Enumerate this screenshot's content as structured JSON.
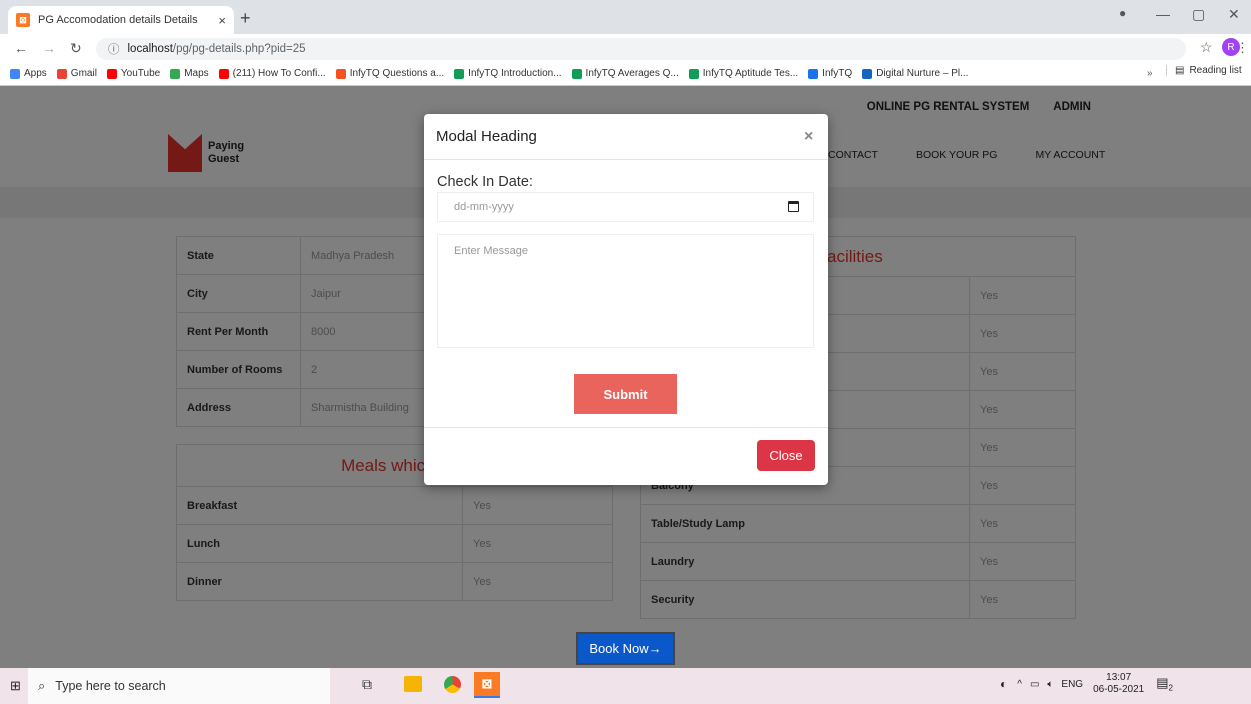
{
  "browser": {
    "tab_title": "PG Accomodation details Details",
    "tab_close": "×",
    "new_tab": "+",
    "url_host": "localhost",
    "url_path": "/pg/pg-details.php?pid=25",
    "bookmarks": [
      {
        "label": "Apps",
        "color": "#4285f4"
      },
      {
        "label": "Gmail",
        "color": "#ea4335"
      },
      {
        "label": "YouTube",
        "color": "#ff0000"
      },
      {
        "label": "Maps",
        "color": "#34a853"
      },
      {
        "label": "(211) How To Confi...",
        "color": "#ff0000"
      },
      {
        "label": "InfyTQ Questions a...",
        "color": "#f4511e"
      },
      {
        "label": "InfyTQ Introduction...",
        "color": "#0f9d58"
      },
      {
        "label": "InfyTQ Averages Q...",
        "color": "#0f9d58"
      },
      {
        "label": "InfyTQ Aptitude Tes...",
        "color": "#0f9d58"
      },
      {
        "label": "InfyTQ",
        "color": "#1a73e8"
      },
      {
        "label": "Digital Nurture – Pl...",
        "color": "#1565c0"
      }
    ],
    "reading_list": "Reading list",
    "overflow": "»"
  },
  "site": {
    "top_links": [
      "ONLINE PG RENTAL SYSTEM",
      "ADMIN"
    ],
    "logo_line1": "Paying",
    "logo_line2": "Guest",
    "nav": [
      "CONTACT",
      "BOOK YOUR PG",
      "MY ACCOUNT"
    ],
    "details": [
      {
        "key": "State",
        "value": "Madhya Pradesh"
      },
      {
        "key": "City",
        "value": "Jaipur"
      },
      {
        "key": "Rent Per Month",
        "value": "8000"
      },
      {
        "key": "Number of Rooms",
        "value": "2"
      },
      {
        "key": "Address",
        "value": "Sharmistha Building"
      }
    ],
    "meals_heading": "Meals which off",
    "meals": [
      {
        "key": "Breakfast",
        "value": "Yes"
      },
      {
        "key": "Lunch",
        "value": "Yes"
      },
      {
        "key": "Dinner",
        "value": "Yes"
      }
    ],
    "facilities_heading": "acilities",
    "facilities": [
      {
        "key": "",
        "value": "Yes"
      },
      {
        "key": "",
        "value": "Yes"
      },
      {
        "key": "",
        "value": "Yes"
      },
      {
        "key": "",
        "value": "Yes"
      },
      {
        "key": "",
        "value": "Yes"
      },
      {
        "key": "Balcony",
        "value": "Yes"
      },
      {
        "key": "Table/Study Lamp",
        "value": "Yes"
      },
      {
        "key": "Laundry",
        "value": "Yes"
      },
      {
        "key": "Security",
        "value": "Yes"
      }
    ],
    "book_now": "Book Now→"
  },
  "modal": {
    "title": "Modal Heading",
    "close_x": "×",
    "checkin_label": "Check In Date:",
    "date_placeholder": "dd-mm-yyyy",
    "message_placeholder": "Enter Message",
    "submit": "Submit",
    "close": "Close"
  },
  "taskbar": {
    "search_placeholder": "Type here to search",
    "lang": "ENG",
    "time": "13:07",
    "date": "06-05-2021",
    "notif_count": "2"
  }
}
